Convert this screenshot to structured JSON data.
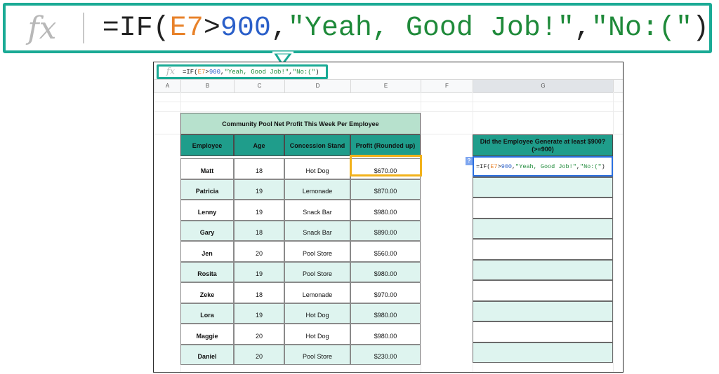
{
  "formula_bar": {
    "fx_label": "fx",
    "parts": [
      "=IF(",
      "E7",
      ">",
      "900",
      ",",
      "\"Yeah, Good Job!\"",
      ",",
      "\"No:(\"",
      ")"
    ]
  },
  "columns": [
    "A",
    "B",
    "C",
    "D",
    "E",
    "F",
    "G"
  ],
  "table": {
    "title": "Community Pool Net Profit This Week Per Employee",
    "headers": [
      "Employee",
      "Age",
      "Concession Stand",
      "Profit (Rounded up)"
    ],
    "rows": [
      [
        "Matt",
        "18",
        "Hot Dog",
        "$670.00"
      ],
      [
        "Patricia",
        "19",
        "Lemonade",
        "$870.00"
      ],
      [
        "Lenny",
        "19",
        "Snack Bar",
        "$980.00"
      ],
      [
        "Gary",
        "18",
        "Snack Bar",
        "$890.00"
      ],
      [
        "Jen",
        "20",
        "Pool Store",
        "$560.00"
      ],
      [
        "Rosita",
        "19",
        "Pool Store",
        "$980.00"
      ],
      [
        "Zeke",
        "18",
        "Lemonade",
        "$970.00"
      ],
      [
        "Lora",
        "19",
        "Hot Dog",
        "$980.00"
      ],
      [
        "Maggie",
        "20",
        "Hot Dog",
        "$980.00"
      ],
      [
        "Daniel",
        "20",
        "Pool Store",
        "$230.00"
      ]
    ]
  },
  "result_column": {
    "header": "Did the Employee Generate at least $900? (>=900)",
    "help_badge": "?"
  },
  "colors": {
    "accent_teal": "#1aaa95",
    "header_teal": "#1f9d8b",
    "title_green": "#b7e1cd",
    "row_tint": "#def4ef",
    "highlight": "#f2b21b",
    "active_blue": "#2a6fe0",
    "ref_orange": "#e8822a",
    "number_blue": "#2a5fc9",
    "string_green": "#1f8a3a"
  }
}
